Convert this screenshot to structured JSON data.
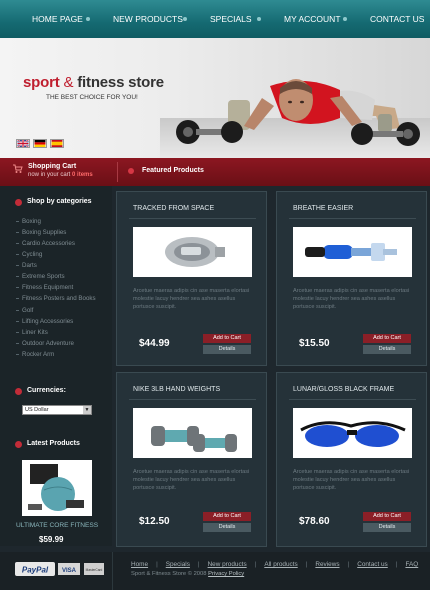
{
  "nav": {
    "items": [
      "HOME PAGE",
      "NEW PRODUCTS",
      "SPECIALS",
      "MY ACCOUNT",
      "CONTACT US"
    ]
  },
  "banner": {
    "logo_sport": "sport",
    "logo_amp": "&",
    "logo_fitness": "fitness store",
    "tagline": "THE BEST CHOICE FOR YOU!",
    "languages": [
      "English",
      "German",
      "Spanish"
    ]
  },
  "cart": {
    "title": "Shopping Cart",
    "subtitle_prefix": "now in your cart",
    "item_count": "0 items"
  },
  "featured": {
    "title": "Featured Products"
  },
  "sidebar": {
    "categories_title": "Shop by categories",
    "categories": [
      "Boxing",
      "Boxing Supplies",
      "Cardio Accessories",
      "Cycling",
      "Darts",
      "Extreme Sports",
      "Fitness Equipment",
      "Fitness Posters and Books",
      "Golf",
      "Lifting Accessories",
      "Liner Kits",
      "Outdoor Adventure",
      "Rocker Arm"
    ],
    "currencies_title": "Currencies:",
    "currency_selected": "US Dollar",
    "latest_title": "Latest Products",
    "latest_name": "ULTIMATE CORE FITNESS",
    "latest_price": "$59.99"
  },
  "products": [
    {
      "title": "TRACKED FROM SPACE",
      "desc": "Arcetue maeras adipis cin ase maserta elortasi molestie lacuy hendrer sea ashes asellus portusce suscipit.",
      "price": "$44.99",
      "icon": "pedometer-icon"
    },
    {
      "title": "BREATHE EASIER",
      "desc": "Arcetue maeras adipis cin ase maserta elortasi molestie lacuy hendrer sea ashes asellus portusce suscipit.",
      "price": "$15.50",
      "icon": "breathing-trainer-icon"
    },
    {
      "title": "NIKE 3LB HAND WEIGHTS",
      "desc": "Arcetue maeras adipis cin ase maserta elortasi molestie lacuy hendrer sea ashes asellus portusce suscipit.",
      "price": "$12.50",
      "icon": "hand-weights-icon"
    },
    {
      "title": "LUNAR/GLOSS BLACK FRAME",
      "desc": "Arcetue maeras adipis cin ase maserta elortasi molestie lacuy hendrer sea ashes asellus portusce suscipit.",
      "price": "$78.60",
      "icon": "sunglasses-icon"
    }
  ],
  "buttons": {
    "add_to_cart": "Add to Cart",
    "details": "Details"
  },
  "footer": {
    "links": [
      "Home",
      "Specials",
      "New products",
      "All products",
      "Reviews",
      "Contact us",
      "FAQ"
    ],
    "copyright": "Sport & Fitness Store © 2008",
    "privacy": "Privacy Policy",
    "payments": [
      "PayPal",
      "VISA",
      "MasterCard"
    ]
  },
  "colors": {
    "teal_nav": "#156a72",
    "brand_red": "#bf1e2e",
    "dark_bg": "#1e272d"
  }
}
